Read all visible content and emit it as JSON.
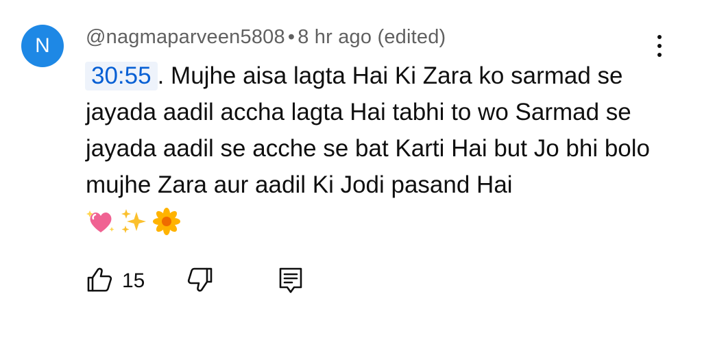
{
  "comment": {
    "avatar_letter": "N",
    "avatar_color": "#1e88e5",
    "author": "@nagmaparveen5808",
    "separator": "•",
    "time": "8 hr ago (edited)",
    "timestamp_link": "30:55",
    "text_after_timestamp": ". Mujhe aisa lagta Hai Ki Zara ko sarmad se jayada aadil accha lagta Hai tabhi to wo Sarmad se jayada aadil se acche se bat Karti Hai but Jo bhi bolo mujhe Zara aur aadil Ki Jodi pasand Hai",
    "emojis": [
      "sparkling-heart",
      "sparkles",
      "blossom"
    ],
    "like_count": "15",
    "link_color": "#065fd4"
  },
  "icons": {
    "more": "more-vert-icon",
    "like": "thumb-up-icon",
    "dislike": "thumb-down-icon",
    "reply": "comment-icon"
  }
}
